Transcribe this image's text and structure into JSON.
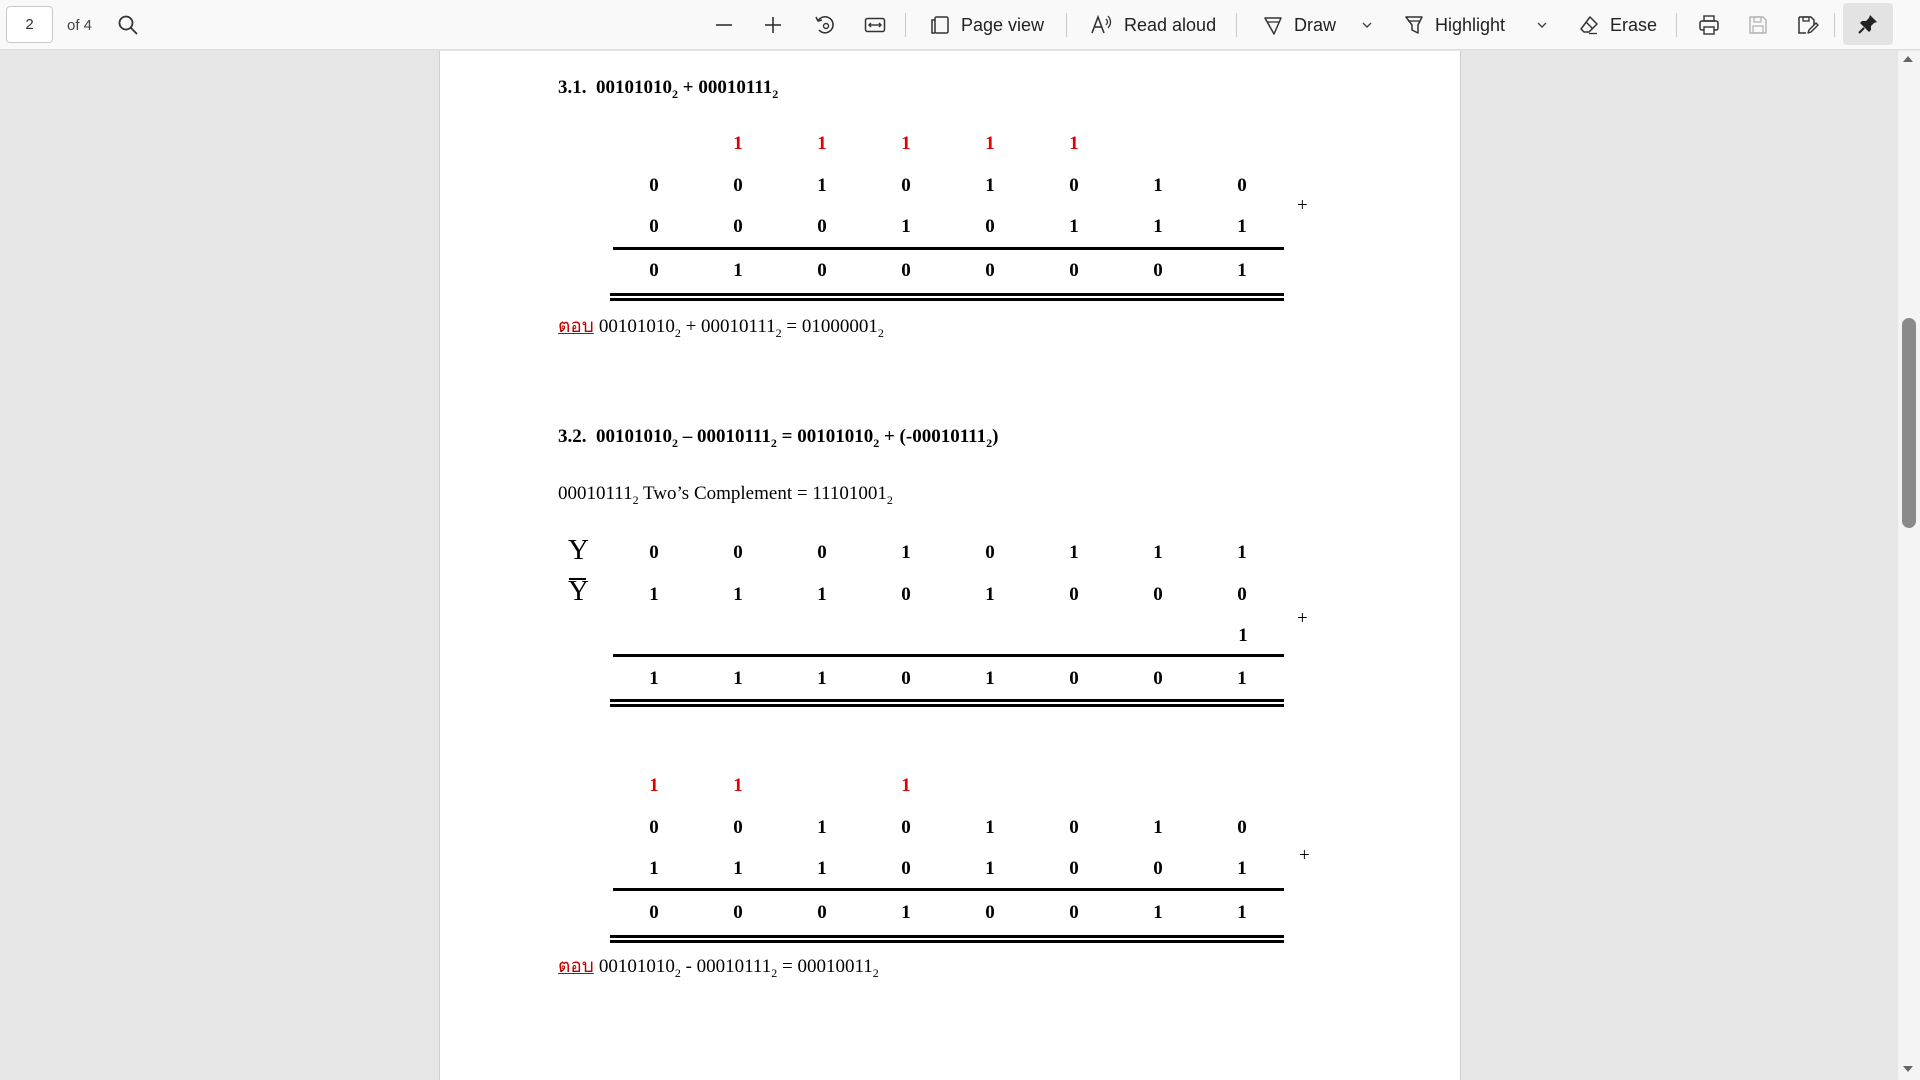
{
  "toolbar": {
    "page_number": "2",
    "page_count": "of 4",
    "page_view_label": "Page view",
    "read_aloud_label": "Read aloud",
    "draw_label": "Draw",
    "highlight_label": "Highlight",
    "erase_label": "Erase"
  },
  "doc": {
    "s31": {
      "label": "3.1.",
      "a": "00101010",
      "op": "+",
      "b": "00010111",
      "base": "2"
    },
    "s31_table": {
      "carry": [
        "",
        "1",
        "1",
        "1",
        "1",
        "1",
        "",
        ""
      ],
      "row1": [
        "0",
        "0",
        "1",
        "0",
        "1",
        "0",
        "1",
        "0"
      ],
      "row2": [
        "0",
        "0",
        "0",
        "1",
        "0",
        "1",
        "1",
        "1"
      ],
      "result": [
        "0",
        "1",
        "0",
        "0",
        "0",
        "0",
        "0",
        "1"
      ],
      "plus": "+"
    },
    "s31_answer": {
      "label": "ตอบ",
      "a": "00101010",
      "op": "+",
      "b": "00010111",
      "eq": "=",
      "r": "01000001",
      "base": "2"
    },
    "s32": {
      "label": "3.2.",
      "a": "00101010",
      "minus": "–",
      "b": "00010111",
      "eq": "=",
      "plus": "+ (-",
      "close": ")",
      "base": "2"
    },
    "twos_complement": {
      "value": "00010111",
      "text": "Two’s Complement =",
      "result": "11101001",
      "base": "2"
    },
    "complement_table": {
      "y_label": "Y",
      "ybar_label": "Y",
      "y": [
        "0",
        "0",
        "0",
        "1",
        "0",
        "1",
        "1",
        "1"
      ],
      "ybar": [
        "1",
        "1",
        "1",
        "0",
        "1",
        "0",
        "0",
        "0"
      ],
      "add_one": "1",
      "result": [
        "1",
        "1",
        "1",
        "0",
        "1",
        "0",
        "0",
        "1"
      ],
      "plus": "+"
    },
    "s32_table": {
      "carry": [
        "1",
        "1",
        "",
        "1",
        "",
        "",
        "",
        ""
      ],
      "row1": [
        "0",
        "0",
        "1",
        "0",
        "1",
        "0",
        "1",
        "0"
      ],
      "row2": [
        "1",
        "1",
        "1",
        "0",
        "1",
        "0",
        "0",
        "1"
      ],
      "result": [
        "0",
        "0",
        "0",
        "1",
        "0",
        "0",
        "1",
        "1"
      ],
      "plus": "+"
    },
    "s32_answer": {
      "label": "ตอบ",
      "a": "00101010",
      "op": "-",
      "b": "00010111",
      "eq": "=",
      "r": "00010011",
      "base": "2"
    }
  },
  "colors": {
    "carry": "#e00000",
    "answer_label": "#c00000"
  },
  "icons": [
    "search-icon",
    "zoom-out-icon",
    "zoom-in-icon",
    "rotate-icon",
    "fit-width-icon",
    "page-view-icon",
    "read-aloud-icon",
    "draw-icon",
    "chevron-down-icon",
    "highlight-icon",
    "erase-icon",
    "print-icon",
    "save-icon",
    "save-as-icon",
    "pin-icon"
  ]
}
